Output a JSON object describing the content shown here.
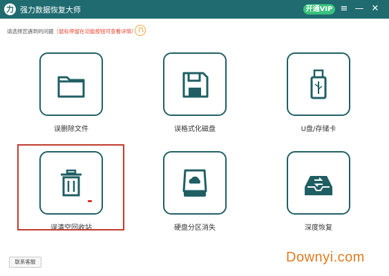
{
  "app": {
    "logo_glyph": "力",
    "title": "强力数据恢复大师",
    "vip_label": "开通VIP",
    "menu_glyph": "≡",
    "minimize_glyph": "—",
    "close_glyph": "✕"
  },
  "hint": {
    "prefix": "请选择您遇到的问题",
    "note": "（鼠标停留在功能按钮可查看详情）"
  },
  "tiles": [
    {
      "label": "误删除文件",
      "icon": "folder-icon"
    },
    {
      "label": "误格式化磁盘",
      "icon": "floppy-disk-icon"
    },
    {
      "label": "U盘/存储卡",
      "icon": "usb-drive-icon"
    },
    {
      "label": "误清空回收站",
      "icon": "trash-can-icon"
    },
    {
      "label": "硬盘分区消失",
      "icon": "hard-drive-icon"
    },
    {
      "label": "深度恢复",
      "icon": "deep-recovery-icon"
    }
  ],
  "footer": {
    "support_label": "联系客服"
  },
  "watermark": "Downyi.com",
  "colors": {
    "titlebar": "#1f6b70",
    "tile_border": "#1f5e63",
    "vip": "#39c37c",
    "hint_red": "#e8412c",
    "highlight": "#c0392b",
    "watermark": "#e07b1f"
  }
}
